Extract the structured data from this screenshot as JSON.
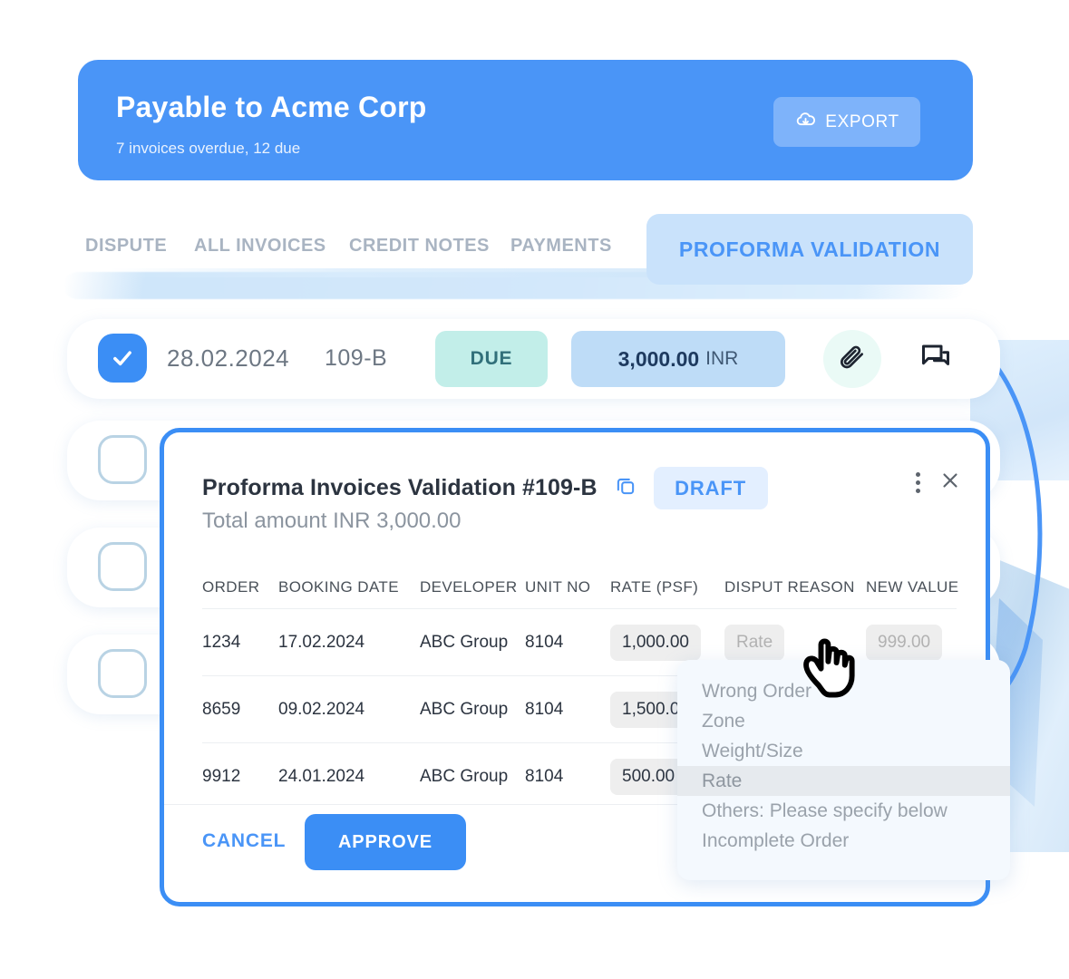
{
  "banner": {
    "title": "Payable to Acme Corp",
    "subtitle": "7 invoices overdue, 12 due",
    "export_label": "EXPORT",
    "export_icon": "cloud-download-icon",
    "bg_color": "#4a95f7"
  },
  "tabs": {
    "items": [
      {
        "label": "DISPUTE"
      },
      {
        "label": "ALL INVOICES"
      },
      {
        "label": "CREDIT NOTES"
      },
      {
        "label": "PAYMENTS"
      }
    ],
    "active": {
      "label": "PROFORMA VALIDATION",
      "color": "#4a95f7",
      "bg_color": "#c9e2fb"
    }
  },
  "invoice_row": {
    "checkbox_checked": true,
    "date": "28.02.2024",
    "number": "109-B",
    "status": "DUE",
    "status_bg": "#c2eee9",
    "amount": "3,000.00",
    "currency": "INR",
    "amount_bg": "#bedcf7",
    "attachment_icon": "paperclip-icon",
    "comment_icon": "chat-bubbles-icon"
  },
  "background_rows": [
    {
      "checkbox_checked": false
    },
    {
      "checkbox_checked": false
    },
    {
      "checkbox_checked": false
    }
  ],
  "modal": {
    "title": "Proforma Invoices Validation #109-B",
    "copy_icon": "copy-icon",
    "status_badge": "DRAFT",
    "status_badge_bg": "#e3efff",
    "subtitle": "Total amount INR 3,000.00",
    "menu_icon": "kebab-menu-icon",
    "close_icon": "close-icon",
    "border_color": "#3b8ef5",
    "table": {
      "headers": [
        "ORDER",
        "BOOKING DATE",
        "DEVELOPER",
        "UNIT NO",
        "RATE (PSF)",
        "DISPUT REASON",
        "NEW VALUE"
      ],
      "rows": [
        {
          "order": "1234",
          "booking_date": "17.02.2024",
          "developer": "ABC Group",
          "unit_no": "8104",
          "rate": "1,000.00",
          "dispute_reason_placeholder": "Rate",
          "dispute_reason_value": "",
          "new_value_placeholder": "999.00",
          "new_value": ""
        },
        {
          "order": "8659",
          "booking_date": "09.02.2024",
          "developer": "ABC Group",
          "unit_no": "8104",
          "rate": "1,500.00",
          "dispute_reason_placeholder": "",
          "dispute_reason_value": "",
          "new_value_placeholder": "",
          "new_value": ""
        },
        {
          "order": "9912",
          "booking_date": "24.01.2024",
          "developer": "ABC Group",
          "unit_no": "8104",
          "rate": "500.00",
          "dispute_reason_placeholder": "",
          "dispute_reason_value": "",
          "new_value_placeholder": "",
          "new_value": ""
        }
      ]
    },
    "footer": {
      "cancel_label": "CANCEL",
      "approve_label": "APPROVE",
      "approve_bg": "#3b8ef5"
    }
  },
  "dropdown": {
    "options": [
      {
        "label": "Wrong Order",
        "selected": false
      },
      {
        "label": "Zone",
        "selected": false
      },
      {
        "label": "Weight/Size",
        "selected": false
      },
      {
        "label": "Rate",
        "selected": true
      },
      {
        "label": "Others: Please specify below",
        "selected": false
      },
      {
        "label": "Incomplete Order",
        "selected": false
      }
    ],
    "bg_color": "#f4f9fe",
    "selected_bg": "#e6eaee"
  },
  "cursor": {
    "icon": "pointing-hand-cursor"
  }
}
